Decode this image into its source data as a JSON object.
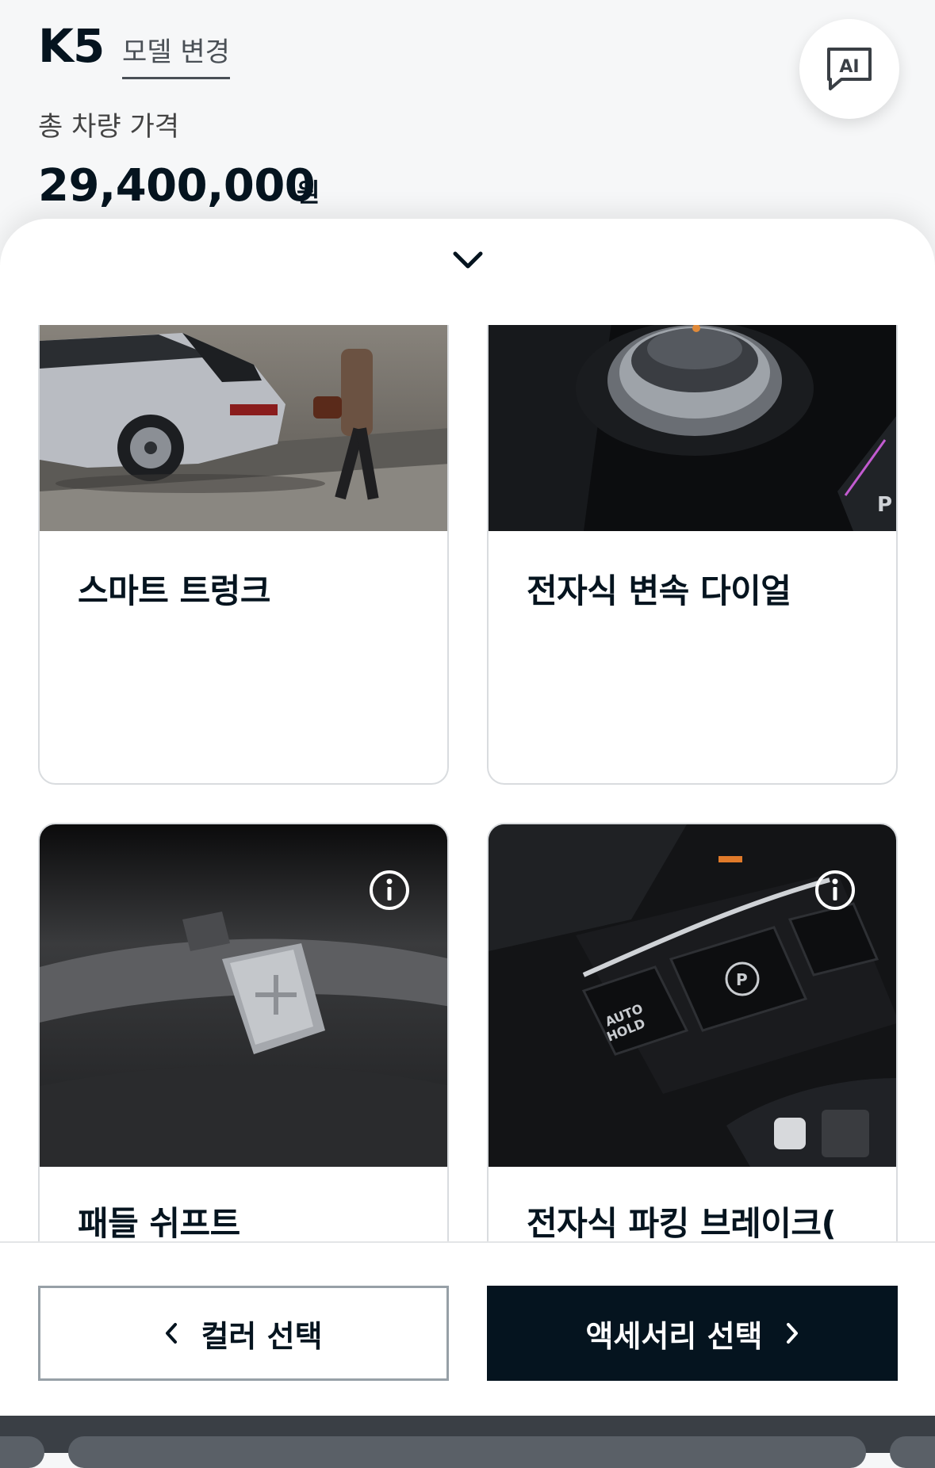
{
  "header": {
    "model_name": "K5",
    "model_change_label": "모델 변경",
    "price_label": "총 차량 가격",
    "price_value": "29,400,000",
    "price_unit": "원",
    "ai_button_label": "AI"
  },
  "options": [
    {
      "title": "스마트 트렁크",
      "image_icon": "car-trunk-photo",
      "has_info": false
    },
    {
      "title": "전자식 변속 다이얼",
      "image_icon": "gear-dial-photo",
      "has_info": false
    },
    {
      "title": "패들 쉬프트",
      "image_icon": "paddle-shift-photo",
      "has_info": true
    },
    {
      "title": "전자식 파킹 브레이크(",
      "image_icon": "parking-brake-photo",
      "has_info": true
    }
  ],
  "footer": {
    "prev_label": "컬러 선택",
    "next_label": "액세서리 선택"
  },
  "colors": {
    "primary": "#05141f",
    "border": "#d9dcdf",
    "background": "#f6f7f8"
  }
}
